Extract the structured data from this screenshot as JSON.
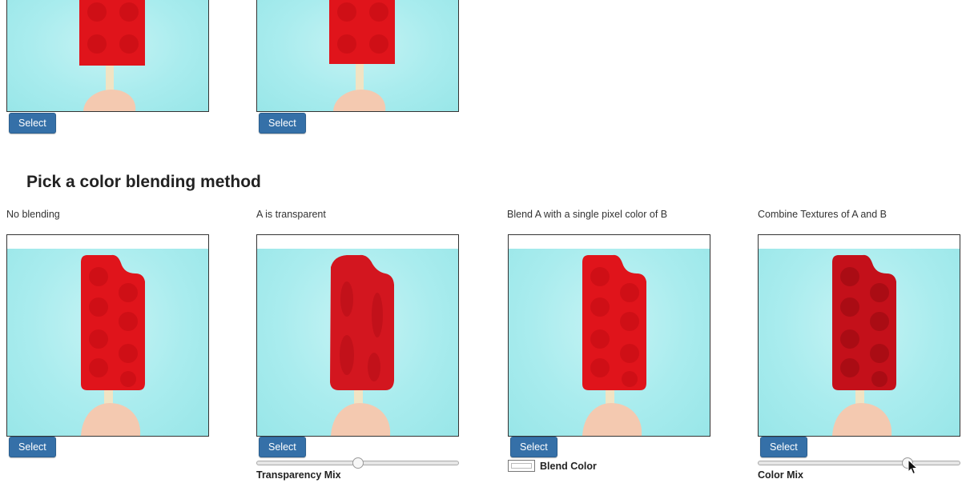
{
  "colors": {
    "accent": "#3570a8",
    "popsicle": "#e0141b",
    "background": "#a9ecee"
  },
  "top_row": {
    "buttons": [
      "Select",
      "Select"
    ]
  },
  "section": {
    "title": "Pick a color blending method"
  },
  "methods": [
    {
      "label": "No blending",
      "button": "Select"
    },
    {
      "label": "A is transparent",
      "button": "Select",
      "control_label": "Transparency Mix",
      "slider_value": 0.5
    },
    {
      "label": "Blend A with a single pixel color of B",
      "button": "Select",
      "control_label": "Blend Color"
    },
    {
      "label": "Combine Textures of A and B",
      "button": "Select",
      "control_label": "Color Mix",
      "slider_value": 0.74
    }
  ],
  "icons": {
    "cursor": "mouse-pointer-icon"
  }
}
